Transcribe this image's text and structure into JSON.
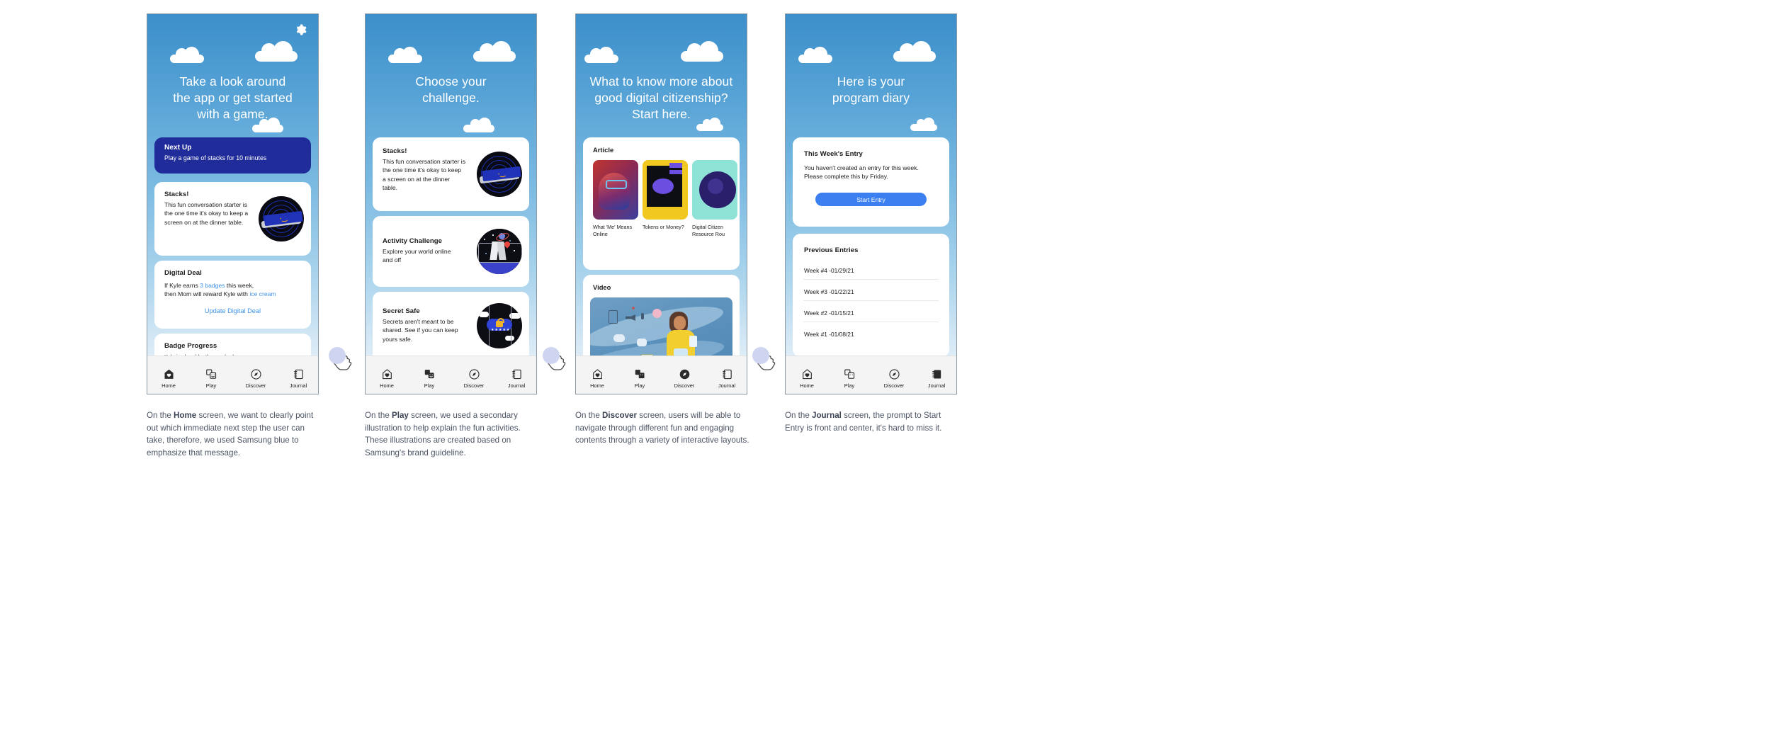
{
  "meta": {
    "colors": {
      "samsung_blue": "#1f2c9a",
      "accent_link": "#3f93e8",
      "button_blue": "#3c7ff0",
      "sky_top": "#3c8fca",
      "sky_bottom": "#e8f2f9",
      "page_bg": "#f2f2f2"
    }
  },
  "nav": {
    "items": [
      {
        "label": "Home",
        "icon": "home-heart-icon"
      },
      {
        "label": "Play",
        "icon": "theater-masks-icon"
      },
      {
        "label": "Discover",
        "icon": "compass-icon"
      },
      {
        "label": "Journal",
        "icon": "notebook-icon"
      }
    ]
  },
  "screens": [
    {
      "id": "home",
      "header": "Take a look around\nthe app or get started\nwith a game.",
      "header_lines": [
        "Take a look around",
        "the app or get started",
        "with a game."
      ],
      "gear_icon": "gear-icon",
      "next_up": {
        "title": "Next Up",
        "subtitle": "Play a game of stacks for 10 minutes"
      },
      "stacks_card": {
        "title": "Stacks!",
        "body": "This fun conversation starter is the one time it's okay to keep a screen on at the dinner table.",
        "illustration": "stacks-tablet-wink-illustration"
      },
      "digital_deal": {
        "title": "Digital Deal",
        "line1_a": "If Kyle earns ",
        "line1_link": "3 badges",
        "line1_b": " this week,",
        "line2_a": "then Mom will reward Kyle with ",
        "line2_link": "ice cream",
        "action": "Update Digital Deal"
      },
      "badge_progress": {
        "title": "Badge Progress",
        "subtitle": "Kyle is ahead by the one badge",
        "badge_colors": [
          "#d9453c",
          "#2f84d4",
          "#7cc143"
        ]
      },
      "active_tab": "Home"
    },
    {
      "id": "play",
      "header_lines": [
        "Choose your",
        "challenge."
      ],
      "cards": [
        {
          "title": "Stacks!",
          "body": "This fun conversation starter is the one time it's okay to keep a screen on at the dinner table.",
          "illustration": "stacks-tablet-wink-illustration"
        },
        {
          "title": "Activity Challenge",
          "body": "Explore your world online and off",
          "illustration": "space-map-pin-illustration"
        },
        {
          "title": "Secret Safe",
          "body": "Secrets aren't meant to be shared. See if you can keep yours safe.",
          "illustration": "phone-lock-cloud-illustration"
        }
      ],
      "active_tab": "Play"
    },
    {
      "id": "discover",
      "header_lines": [
        "What to know more about",
        "good digital citizenship?",
        "Start here."
      ],
      "article_section": {
        "title": "Article",
        "thumbs": [
          {
            "caption": "What 'Me' Means Online",
            "art": "neon-portrait-thumb"
          },
          {
            "caption": "Tokens or Money?",
            "art": "abstract-yellow-thumb"
          },
          {
            "caption": "Digital Citizen Resource Rou",
            "art": "teal-purple-thumb"
          }
        ]
      },
      "video_section": {
        "title": "Video",
        "art": "girl-with-phone-illustration"
      },
      "active_tab": "Discover"
    },
    {
      "id": "journal",
      "header_lines": [
        "Here is your",
        "program diary"
      ],
      "this_week": {
        "title": "This Week's Entry",
        "line1": "You haven't created an entry for this week.",
        "line2": "Please complete this by Friday.",
        "button": "Start Entry"
      },
      "previous": {
        "title": "Previous Entries",
        "entries": [
          "Week #4 -01/29/21",
          "Week #3 -01/22/21",
          "Week #2 -01/15/21",
          "Week #1 -01/08/21"
        ]
      },
      "active_tab": "Journal"
    }
  ],
  "captions": [
    {
      "prefix": "On the ",
      "bold": "Home",
      "rest": " screen,  we want to clearly point out which immediate next step the user can take, therefore, we used Samsung blue to emphasize that message."
    },
    {
      "prefix": "On the ",
      "bold": "Play",
      "rest": " screen, we used a secondary illustration to help explain the fun activities. These illustrations are created based on Samsung's brand guideline."
    },
    {
      "prefix": "On the ",
      "bold": "Discover",
      "rest": " screen, users will be able to navigate through different fun and engaging contents through a variety of interactive layouts."
    },
    {
      "prefix": "On the ",
      "bold": "Journal",
      "rest": " screen, the prompt to Start Entry is front and center, it's hard to miss it."
    }
  ]
}
